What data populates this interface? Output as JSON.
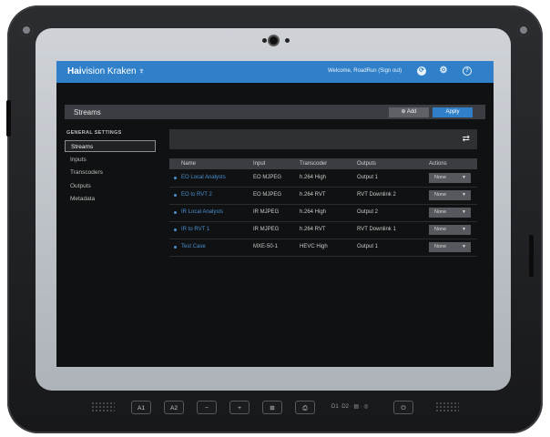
{
  "app": {
    "brand_bold": "Hai",
    "brand_rest": "vision Kraken",
    "welcome": "Welcome, RoadRun (Sign out)"
  },
  "header": {
    "title": "Streams",
    "add_label": "Add",
    "apply_label": "Apply"
  },
  "sidebar": {
    "heading": "GENERAL SETTINGS",
    "items": [
      {
        "label": "Streams",
        "active": true
      },
      {
        "label": "Inputs",
        "active": false
      },
      {
        "label": "Transcoders",
        "active": false
      },
      {
        "label": "Outputs",
        "active": false
      },
      {
        "label": "Metadata",
        "active": false
      }
    ]
  },
  "table": {
    "columns": [
      "Name",
      "Input",
      "Transcoder",
      "Outputs",
      "Actions"
    ],
    "rows": [
      {
        "name": "EO Local Analysts",
        "input": "EO MJPEG",
        "transcoder": "h.264 High",
        "outputs": "Output 1",
        "action": "None"
      },
      {
        "name": "EO to RVT 2",
        "input": "EO MJPEG",
        "transcoder": "h.264 RVT",
        "outputs": "RVT Downlink 2",
        "action": "None"
      },
      {
        "name": "IR Local Analysts",
        "input": "IR MJPEG",
        "transcoder": "h.264 High",
        "outputs": "Output 2",
        "action": "None"
      },
      {
        "name": "IR to RVT 1",
        "input": "IR MJPEG",
        "transcoder": "h.264 RVT",
        "outputs": "RVT Downlink 1",
        "action": "None"
      },
      {
        "name": "Test Case",
        "input": "MXE-50-1",
        "transcoder": "HEVC High",
        "outputs": "Output 1",
        "action": "None"
      }
    ]
  },
  "hardware": {
    "buttons": [
      "A1",
      "A2",
      "−",
      "+",
      "⊞",
      "⎙",
      "⏻"
    ],
    "indicators": "·D1 ·D2 · ▤ · ◎"
  },
  "icons": {
    "topbar": [
      "refresh-icon",
      "gear-icon",
      "help-icon"
    ],
    "refresh": "refresh-icon",
    "add": "plus-circle-icon"
  },
  "colors": {
    "accent": "#2f80c8",
    "link": "#4a8fd0",
    "background": "#101112"
  }
}
